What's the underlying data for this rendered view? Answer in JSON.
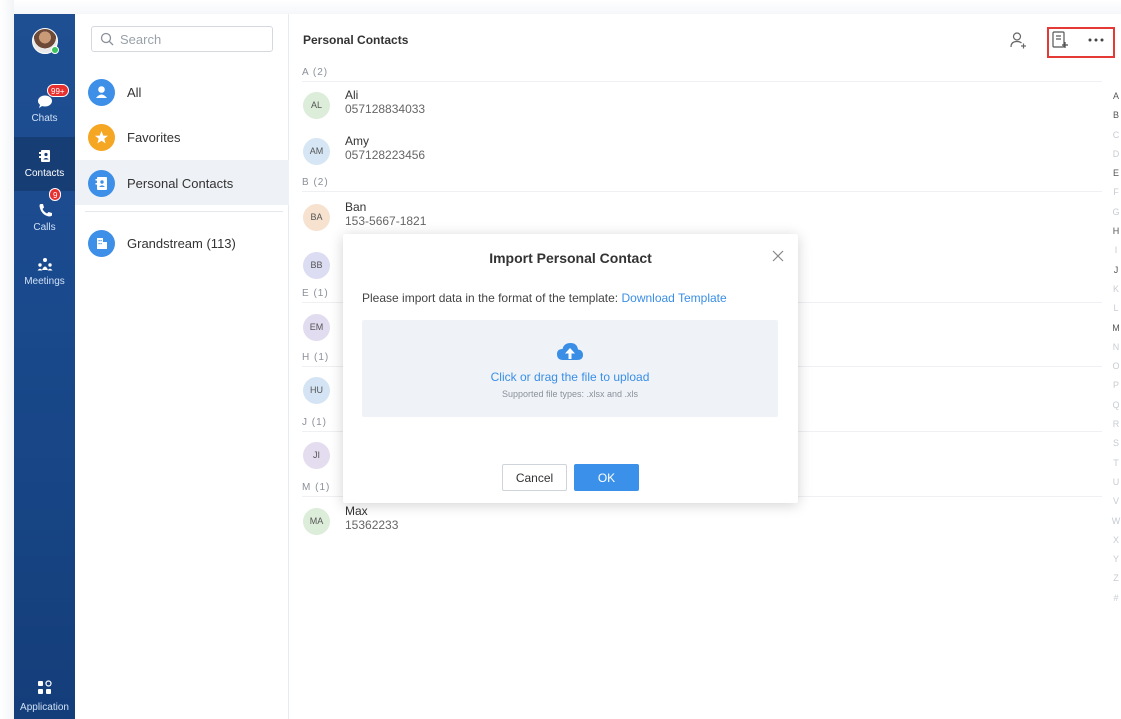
{
  "nav": {
    "items": [
      {
        "label": "Chats",
        "badge": "99+"
      },
      {
        "label": "Contacts",
        "badge": ""
      },
      {
        "label": "Calls",
        "badge": "9"
      },
      {
        "label": "Meetings",
        "badge": ""
      }
    ],
    "app_label": "Application"
  },
  "sidebar": {
    "search_placeholder": "Search",
    "categories": [
      {
        "label": "All",
        "color": "#3d8fe8"
      },
      {
        "label": "Favorites",
        "color": "#f5a623"
      },
      {
        "label": "Personal Contacts",
        "color": "#3d8fe8"
      },
      {
        "label": "Grandstream (113)",
        "color": "#3d8fe8"
      }
    ]
  },
  "main": {
    "title": "Personal Contacts",
    "sections": [
      "A (2)",
      "B (2)",
      "E (1)",
      "H (1)",
      "J (1)",
      "M (1)"
    ],
    "contacts": [
      {
        "initials": "AL",
        "name": "Ali",
        "number": "057128834033",
        "color": "#dcedd9"
      },
      {
        "initials": "AM",
        "name": "Amy",
        "number": "057128223456",
        "color": "#d6e6f5"
      },
      {
        "initials": "BA",
        "name": "Ban",
        "number": "153-5667-1821",
        "color": "#f6e2cf"
      },
      {
        "initials": "BB",
        "name": "",
        "number": "",
        "color": "#dcdcf2"
      },
      {
        "initials": "EM",
        "name": "",
        "number": "",
        "color": "#e1dcef"
      },
      {
        "initials": "HU",
        "name": "",
        "number": "",
        "color": "#d4e4f4"
      },
      {
        "initials": "JI",
        "name": "",
        "number": "",
        "color": "#e4dcef"
      },
      {
        "initials": "MA",
        "name": "Max",
        "number": "15362233",
        "color": "#dcedd9"
      }
    ],
    "alphabet": [
      "A",
      "B",
      "C",
      "D",
      "E",
      "F",
      "G",
      "H",
      "I",
      "J",
      "K",
      "L",
      "M",
      "N",
      "O",
      "P",
      "Q",
      "R",
      "S",
      "T",
      "U",
      "V",
      "W",
      "X",
      "Y",
      "Z",
      "#"
    ],
    "alphabet_active": [
      "A",
      "B",
      "E",
      "H",
      "J",
      "M"
    ]
  },
  "modal": {
    "title": "Import Personal Contact",
    "desc_prefix": "Please import data in the format of the template:",
    "download_link": "Download Template",
    "upload_main": "Click or drag the file to upload",
    "upload_sub": "Supported file types: .xlsx and .xls",
    "cancel_label": "Cancel",
    "ok_label": "OK"
  },
  "colors": {
    "accent": "#3b91ea",
    "highlight": "#e53935",
    "badge": "#e8312f"
  }
}
